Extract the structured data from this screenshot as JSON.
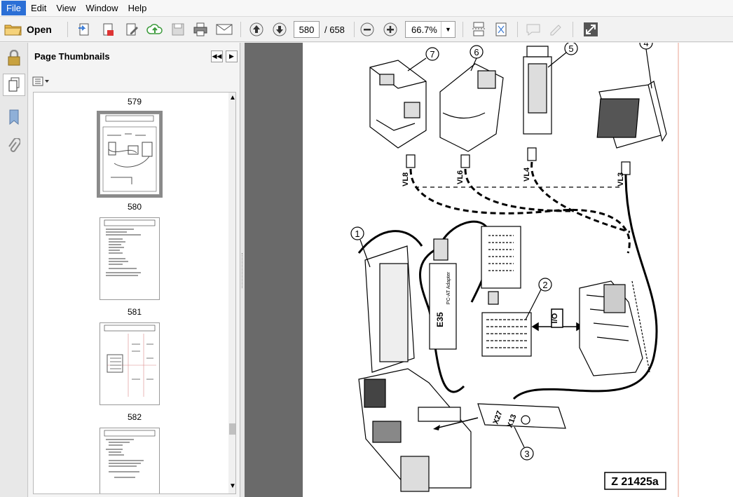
{
  "menu": {
    "file": "File",
    "edit": "Edit",
    "view": "View",
    "window": "Window",
    "help": "Help"
  },
  "toolbar": {
    "open_label": "Open",
    "page_current": "580",
    "page_total": "/ 658",
    "zoom": "66.7%"
  },
  "panel": {
    "title": "Page Thumbnails"
  },
  "thumbnails": {
    "p579": "579",
    "p580": "580",
    "p581": "581",
    "p582": "582"
  },
  "diagram": {
    "numbers": {
      "n1": "1",
      "n2": "2",
      "n3": "3",
      "n4": "4",
      "n5": "5",
      "n6": "6",
      "n7": "7"
    },
    "cables": {
      "vl8": "VL8",
      "vl6": "VL6",
      "vl4": "VL4",
      "vl3": "VL3",
      "x27": "X27",
      "x13": "X13"
    },
    "io_label": "I/O",
    "module_label": "E35",
    "module_sub": "PC-AT Adapter",
    "figure_id": "Z 21425a"
  },
  "colors": {
    "menu_active": "#2b6fd6",
    "viewer_bg": "#6a6a6a",
    "margin_line": "#e8a090"
  }
}
